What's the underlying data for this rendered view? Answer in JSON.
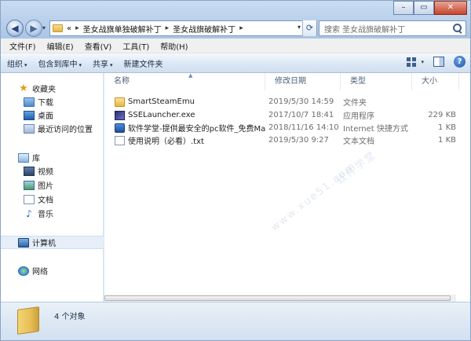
{
  "window": {
    "controls": {
      "minimize": "–",
      "maximize": "▭",
      "close": "✕"
    }
  },
  "navigation": {
    "back": "◀",
    "forward": "▶",
    "dropdown": "▾"
  },
  "address": {
    "prefix": "«",
    "crumbs": [
      "圣女战旗单独破解补丁",
      "圣女战旗破解补丁"
    ],
    "separator": "▸",
    "dropdown": "▾",
    "refresh": "⟳"
  },
  "search": {
    "placeholder": "搜索 圣女战旗破解补丁"
  },
  "menubar": [
    "文件(F)",
    "编辑(E)",
    "查看(V)",
    "工具(T)",
    "帮助(H)"
  ],
  "commandbar": {
    "organize": "组织",
    "include_library": "包含到库中",
    "share": "共享",
    "new_folder": "新建文件夹",
    "arrow": "▾",
    "help": "?"
  },
  "sidebar": {
    "favorites": {
      "label": "收藏夹",
      "items": [
        "下载",
        "桌面",
        "最近访问的位置"
      ]
    },
    "libraries": {
      "label": "库",
      "items": [
        "视频",
        "图片",
        "文档",
        "音乐"
      ]
    },
    "computer": {
      "label": "计算机"
    },
    "network": {
      "label": "网络"
    }
  },
  "columns": {
    "name": "名称",
    "date": "修改日期",
    "type": "类型",
    "size": "大小",
    "sort_indicator": "▲"
  },
  "files": [
    {
      "name": "SmartSteamEmu",
      "date": "2019/5/30 14:59",
      "type": "文件夹",
      "size": "",
      "icon": "folder-icon"
    },
    {
      "name": "SSELauncher.exe",
      "date": "2017/10/7 18:41",
      "type": "应用程序",
      "size": "229 KB",
      "icon": "exe-icon"
    },
    {
      "name": "软件学堂-提供最安全的pc软件_免费Mac...",
      "date": "2018/11/16 14:10",
      "type": "Internet 快捷方式",
      "size": "1 KB",
      "icon": "shortcut-icon"
    },
    {
      "name": "使用说明（必看）.txt",
      "date": "2019/5/30 9:27",
      "type": "文本文档",
      "size": "1 KB",
      "icon": "text-file-icon"
    }
  ],
  "status": {
    "count": "4 个对象"
  },
  "watermark": {
    "text": "软件学堂",
    "url": "www.xue51.com"
  }
}
